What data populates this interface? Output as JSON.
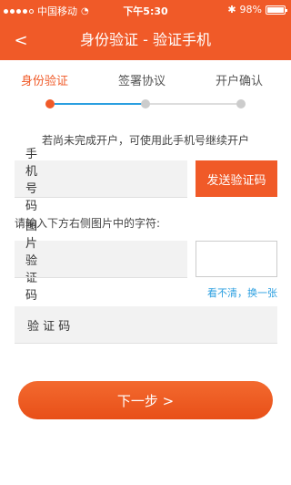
{
  "status_bar": {
    "carrier": "中国移动",
    "time": "下午5:30",
    "battery": "98%",
    "battery_level": 0.98
  },
  "nav": {
    "back_icon": "chevron-left-icon",
    "back_glyph": "<",
    "title": "身份验证 - 验证手机"
  },
  "steps": [
    {
      "label": "身份验证",
      "active": true
    },
    {
      "label": "签署协议",
      "active": false
    },
    {
      "label": "开户确认",
      "active": false
    }
  ],
  "hint": "若尚未完成开户，可使用此手机号继续开户",
  "phone_field": {
    "label": "手机号码",
    "value": ""
  },
  "send_code_button": "发送验证码",
  "image_instruction": "请输入下方右侧图片中的字符:",
  "image_code_field": {
    "label": "图片验证码",
    "value": ""
  },
  "refresh_link": "看不清，换一张",
  "sms_code_field": {
    "label": "验 证 码",
    "value": ""
  },
  "next_button": "下一步 >",
  "colors": {
    "accent": "#f05a28",
    "link": "#2b9fe0"
  }
}
